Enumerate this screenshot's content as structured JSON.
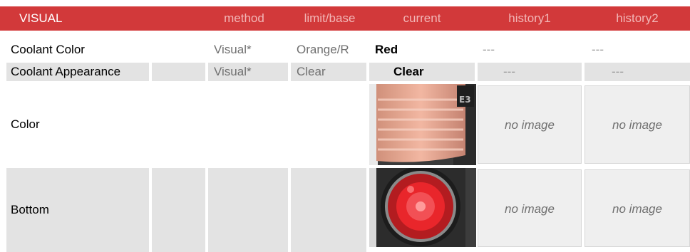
{
  "header": {
    "title": "VISUAL",
    "col_method": "method",
    "col_limit": "limit/base",
    "col_current": "current",
    "col_history1": "history1",
    "col_history2": "history2"
  },
  "rows": {
    "coolant_color": {
      "label": "Coolant Color",
      "method": "Visual*",
      "limit": "Orange/R",
      "current": "Red",
      "history1": "---",
      "history2": "---"
    },
    "coolant_appearance": {
      "label": "Coolant Appearance",
      "method": "Visual*",
      "limit": "Clear",
      "current": "Clear",
      "history1": "---",
      "history2": "---"
    },
    "color_image": {
      "label": "Color",
      "history1": "no image",
      "history2": "no image"
    },
    "bottom_image": {
      "label": "Bottom",
      "history1": "no image",
      "history2": "no image"
    }
  },
  "colors": {
    "header_bg": "#d2393a",
    "header_title": "#ffffff",
    "header_column_text": "#f2b6b6",
    "row_stripe": "#e3e3e3"
  }
}
